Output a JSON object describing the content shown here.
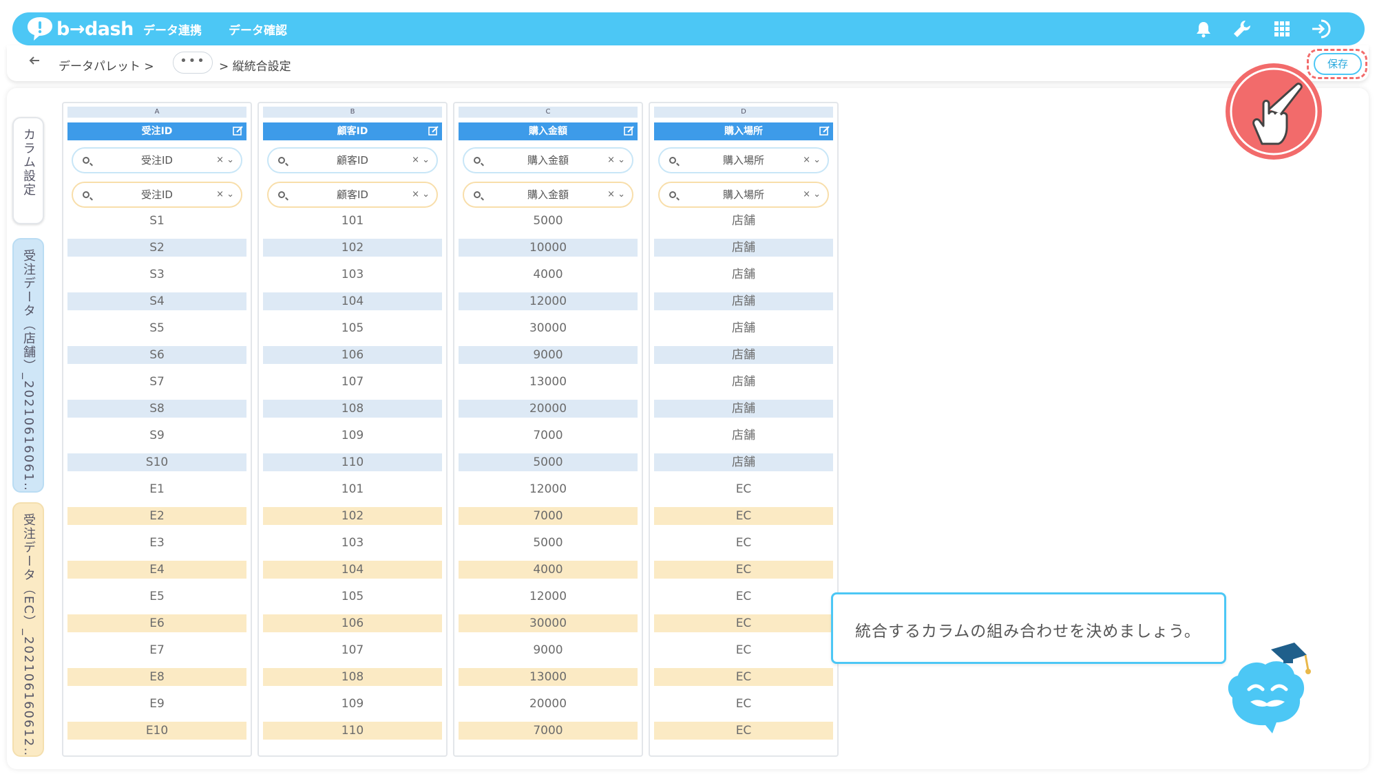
{
  "app": {
    "logo_text": "b→dash",
    "nav": [
      "データ連携",
      "データ確認"
    ]
  },
  "breadcrumb": {
    "back_icon": "arrow-left-icon",
    "root": "データパレット >",
    "ellipsis": "•••",
    "current": "> 縦統合設定",
    "save_label": "保存"
  },
  "side_tabs": [
    {
      "label": "カラム設定",
      "color": "#ffffff"
    },
    {
      "label": "受注データ（店舗）_20210616061…",
      "color": "#cfe6f7"
    },
    {
      "label": "受注データ（EC）_202106160612…",
      "color": "#fbeac4"
    }
  ],
  "columns": [
    {
      "letter": "A",
      "header": "受注ID",
      "select_top": "受注ID",
      "select_bottom": "受注ID",
      "values": [
        "S1",
        "S2",
        "S3",
        "S4",
        "S5",
        "S6",
        "S7",
        "S8",
        "S9",
        "S10",
        "E1",
        "E2",
        "E3",
        "E4",
        "E5",
        "E6",
        "E7",
        "E8",
        "E9",
        "E10"
      ]
    },
    {
      "letter": "B",
      "header": "顧客ID",
      "select_top": "顧客ID",
      "select_bottom": "顧客ID",
      "values": [
        "101",
        "102",
        "103",
        "104",
        "105",
        "106",
        "107",
        "108",
        "109",
        "110",
        "101",
        "102",
        "103",
        "104",
        "105",
        "106",
        "107",
        "108",
        "109",
        "110"
      ]
    },
    {
      "letter": "C",
      "header": "購入金額",
      "select_top": "購入金額",
      "select_bottom": "購入金額",
      "values": [
        "5000",
        "10000",
        "4000",
        "12000",
        "30000",
        "9000",
        "13000",
        "20000",
        "7000",
        "5000",
        "12000",
        "7000",
        "5000",
        "4000",
        "12000",
        "30000",
        "9000",
        "13000",
        "20000",
        "7000"
      ]
    },
    {
      "letter": "D",
      "header": "購入場所",
      "select_top": "購入場所",
      "select_bottom": "購入場所",
      "values": [
        "店舗",
        "店舗",
        "店舗",
        "店舗",
        "店舗",
        "店舗",
        "店舗",
        "店舗",
        "店舗",
        "店舗",
        "EC",
        "EC",
        "EC",
        "EC",
        "EC",
        "EC",
        "EC",
        "EC",
        "EC",
        "EC"
      ]
    }
  ],
  "select_controls": "× ⌄",
  "tooltip": "統合するカラムの組み合わせを決めましょう。",
  "colors": {
    "brand": "#4cc7f5",
    "header_blue": "#3d9be9",
    "row_blue": "#dde9f5",
    "row_yellow": "#fbeac4",
    "highlight_red": "#f26b6b"
  }
}
